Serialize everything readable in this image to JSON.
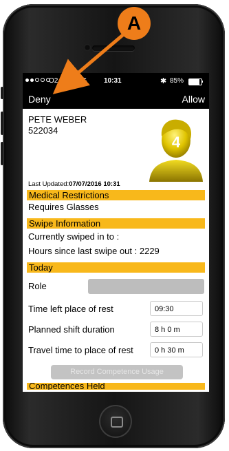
{
  "status_bar": {
    "carrier": "O2",
    "network": "4G",
    "time": "10:31",
    "bluetooth_icon": "bluetooth-icon",
    "battery_percent": "85%",
    "battery_level": 0.85
  },
  "nav": {
    "deny_label": "Deny",
    "allow_label": "Allow"
  },
  "profile": {
    "name": "PETE WEBER",
    "employee_id": "522034",
    "avatar_number": "4",
    "last_updated_label": "Last Updated:",
    "last_updated_value": "07/07/2016 10:31"
  },
  "sections": {
    "medical": "Medical Restrictions",
    "swipe": "Swipe Information",
    "today": "Today",
    "competences": "Competences Held"
  },
  "medical": {
    "restriction": "Requires Glasses"
  },
  "swipe": {
    "currently_swiped_in": "Currently swiped in to :",
    "hours_since_label": "Hours since last swipe out :",
    "hours_since_value": "2229"
  },
  "today": {
    "role_label": "Role",
    "time_left_label": "Time left place of rest",
    "time_left_value": "09:30",
    "planned_shift_label": "Planned shift duration",
    "planned_shift_value": "8 h  0 m",
    "travel_time_label": "Travel time to place of rest",
    "travel_time_value": "0 h 30 m"
  },
  "record_button_label": "Record Competence Usage",
  "callout": {
    "label": "A",
    "color": "#ee7d1a"
  },
  "colors": {
    "section_bg": "#f8b81b",
    "nav_bg": "#000000"
  }
}
